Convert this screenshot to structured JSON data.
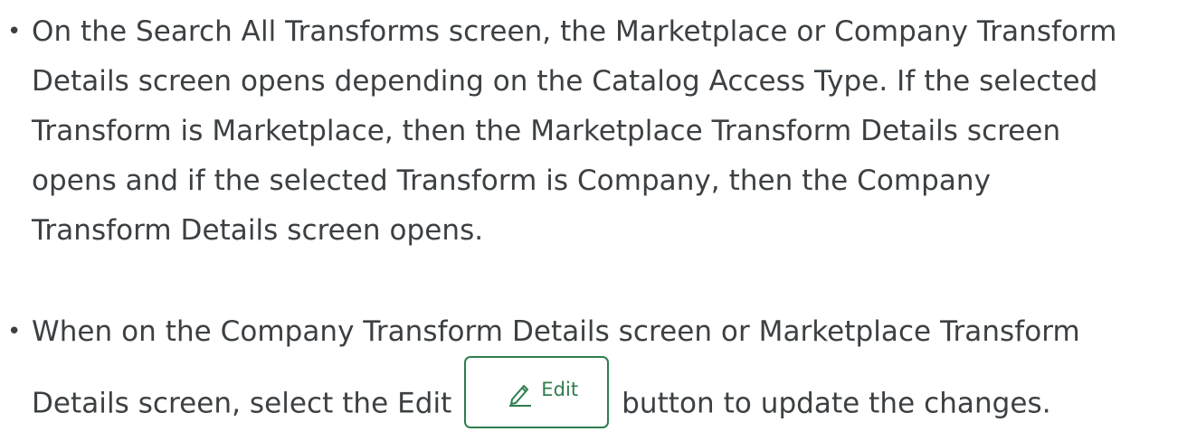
{
  "bullets": [
    {
      "lines": [
        "On the Search All Transforms screen, the Marketplace or Company Transform",
        "Details screen opens depending on the Catalog Access Type. If the selected",
        "Transform is Marketplace, then the Marketplace Transform Details screen",
        "opens and if the selected Transform is Company, then the Company",
        "Transform Details screen opens."
      ]
    },
    {
      "line1": "When on the Company Transform Details screen or Marketplace Transform",
      "line2_before": "Details screen, select the Edit",
      "edit_button_label": "Edit",
      "edit_button_icon": "pencil-icon",
      "line2_after": "button to update the changes."
    }
  ],
  "colors": {
    "text": "#3c4043",
    "accent": "#2f7d4f"
  }
}
